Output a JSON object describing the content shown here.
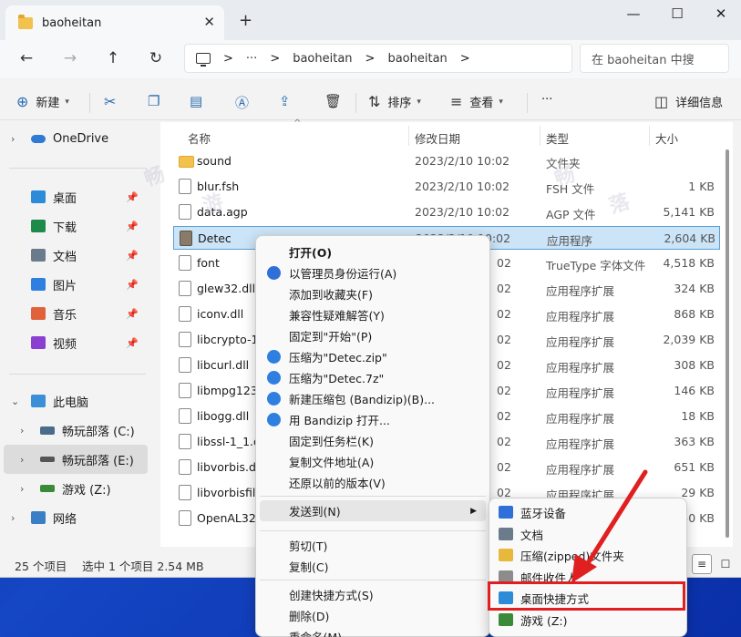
{
  "window": {
    "tab_title": "baoheitan",
    "close_glyph": "✕",
    "new_tab_glyph": "+",
    "minimize_glyph": "—",
    "maximize_glyph": "☐",
    "close_window_glyph": "✕"
  },
  "nav": {
    "back": "←",
    "forward": "→",
    "up": "↑",
    "refresh": "↻",
    "chevron": ">",
    "ellipsis": "···",
    "breadcrumb": [
      "baoheitan",
      "baoheitan"
    ],
    "search_placeholder": "在 baoheitan 中搜"
  },
  "toolbar": {
    "new_label": "新建",
    "sort_label": "排序",
    "view_label": "查看",
    "more_label": "···",
    "details_label": "详细信息"
  },
  "sidebar": {
    "onedrive": "OneDrive",
    "quick": [
      {
        "label": "桌面",
        "color": "#2e8bd8"
      },
      {
        "label": "下载",
        "color": "#1d8a4a"
      },
      {
        "label": "文档",
        "color": "#6b7b8c"
      },
      {
        "label": "图片",
        "color": "#2f7fe0"
      },
      {
        "label": "音乐",
        "color": "#e0623a"
      },
      {
        "label": "视频",
        "color": "#8a3fd1"
      }
    ],
    "this_pc": "此电脑",
    "drives": [
      "畅玩部落 (C:)",
      "畅玩部落 (E:)",
      "游戏 (Z:)"
    ],
    "network": "网络"
  },
  "columns": {
    "name": "名称",
    "date": "修改日期",
    "type": "类型",
    "size": "大小"
  },
  "files": [
    {
      "name": "sound",
      "date": "2023/2/10 10:02",
      "type": "文件夹",
      "size": "",
      "kind": "folder"
    },
    {
      "name": "blur.fsh",
      "date": "2023/2/10 10:02",
      "type": "FSH 文件",
      "size": "1 KB",
      "kind": "file"
    },
    {
      "name": "data.agp",
      "date": "2023/2/10 10:02",
      "type": "AGP 文件",
      "size": "5,141 KB",
      "kind": "file"
    },
    {
      "name": "Detec",
      "date": "2023/2/10 10:02",
      "type": "应用程序",
      "size": "2,604 KB",
      "kind": "app"
    },
    {
      "name": "font",
      "date": "02",
      "type": "TrueType 字体文件",
      "size": "4,518 KB",
      "kind": "file"
    },
    {
      "name": "glew32.dll",
      "date": "02",
      "type": "应用程序扩展",
      "size": "324 KB",
      "kind": "file"
    },
    {
      "name": "iconv.dll",
      "date": "02",
      "type": "应用程序扩展",
      "size": "868 KB",
      "kind": "file"
    },
    {
      "name": "libcrypto-1_",
      "date": "02",
      "type": "应用程序扩展",
      "size": "2,039 KB",
      "kind": "file"
    },
    {
      "name": "libcurl.dll",
      "date": "02",
      "type": "应用程序扩展",
      "size": "308 KB",
      "kind": "file"
    },
    {
      "name": "libmpg123.",
      "date": "02",
      "type": "应用程序扩展",
      "size": "146 KB",
      "kind": "file"
    },
    {
      "name": "libogg.dll",
      "date": "02",
      "type": "应用程序扩展",
      "size": "18 KB",
      "kind": "file"
    },
    {
      "name": "libssl-1_1.d",
      "date": "02",
      "type": "应用程序扩展",
      "size": "363 KB",
      "kind": "file"
    },
    {
      "name": "libvorbis.dl",
      "date": "02",
      "type": "应用程序扩展",
      "size": "651 KB",
      "kind": "file"
    },
    {
      "name": "libvorbisfile",
      "date": "02",
      "type": "应用程序扩展",
      "size": "29 KB",
      "kind": "file"
    },
    {
      "name": "OpenAL32.",
      "date": "02",
      "type": "应用程序扩展",
      "size": "50 KB",
      "kind": "file"
    }
  ],
  "status": {
    "count": "25 个项目",
    "selected": "选中 1 个项目  2.54 MB"
  },
  "context_menu": [
    {
      "label": "打开(O)",
      "bold": true,
      "icon": ""
    },
    {
      "label": "以管理员身份运行(A)",
      "icon": "#2f6fd8"
    },
    {
      "label": "添加到收藏夹(F)",
      "icon": ""
    },
    {
      "label": "兼容性疑难解答(Y)",
      "icon": ""
    },
    {
      "label": "固定到\"开始\"(P)",
      "icon": ""
    },
    {
      "label": "压缩为\"Detec.zip\"",
      "icon": "#2f7fe0"
    },
    {
      "label": "压缩为\"Detec.7z\"",
      "icon": "#2f7fe0"
    },
    {
      "label": "新建压缩包 (Bandizip)(B)...",
      "icon": "#2f7fe0"
    },
    {
      "label": "用 Bandizip 打开...",
      "icon": "#2f7fe0"
    },
    {
      "label": "固定到任务栏(K)",
      "icon": ""
    },
    {
      "label": "复制文件地址(A)",
      "icon": ""
    },
    {
      "label": "还原以前的版本(V)",
      "icon": ""
    },
    {
      "label": "发送到(N)",
      "icon": "",
      "submenu": true
    },
    {
      "label": "剪切(T)",
      "icon": ""
    },
    {
      "label": "复制(C)",
      "icon": ""
    },
    {
      "label": "创建快捷方式(S)",
      "icon": ""
    },
    {
      "label": "删除(D)",
      "icon": ""
    },
    {
      "label": "重命名(M)",
      "icon": ""
    }
  ],
  "send_to": [
    {
      "label": "蓝牙设备",
      "icon": "#2f6fd8"
    },
    {
      "label": "文档",
      "icon": "#6b7b8c"
    },
    {
      "label": "压缩(zipped)文件夹",
      "icon": "#e8b83a"
    },
    {
      "label": "邮件收件人",
      "icon": "#8c8c8c"
    },
    {
      "label": "桌面快捷方式",
      "icon": "#2e8bd8"
    },
    {
      "label": "游戏 (Z:)",
      "icon": "#3a8a3a"
    }
  ],
  "colors": {
    "selection": "#cce4f7",
    "highlight": "#e02020"
  }
}
